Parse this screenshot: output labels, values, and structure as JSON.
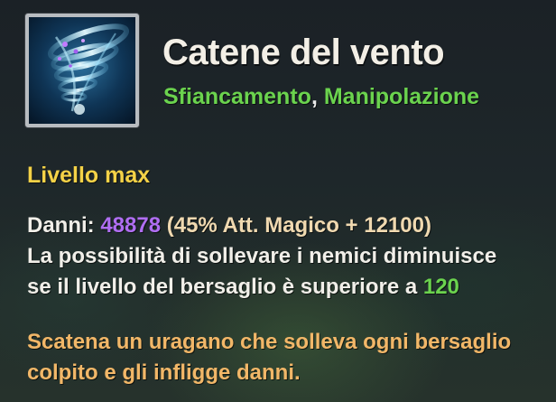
{
  "skill": {
    "icon": "whirlwind-tornado-icon",
    "name": "Catene del vento",
    "tags": [
      "Sfiancamento",
      "Manipolazione"
    ],
    "tag_separator": ", "
  },
  "level_label": "Livello max",
  "damage": {
    "label": "Danni: ",
    "value": "48878",
    "formula": " (45% Att. Magico + 12100)"
  },
  "lift_line_1": "La possibilità di sollevare i nemici diminuisce",
  "lift_line_2_prefix": "se il livello del bersaglio è superiore a ",
  "lift_line_2_value": "120",
  "description": {
    "line_1": "Scatena un uragano che solleva ogni bersaglio",
    "line_2": "colpito e gli infligge danni."
  },
  "colors": {
    "title": "#f3efe6",
    "tag": "#6bd34e",
    "level": "#f4d247",
    "damage_value": "#b06ef2",
    "formula": "#f0d9b0",
    "level_threshold": "#6bd34e",
    "description": "#f2b768"
  }
}
